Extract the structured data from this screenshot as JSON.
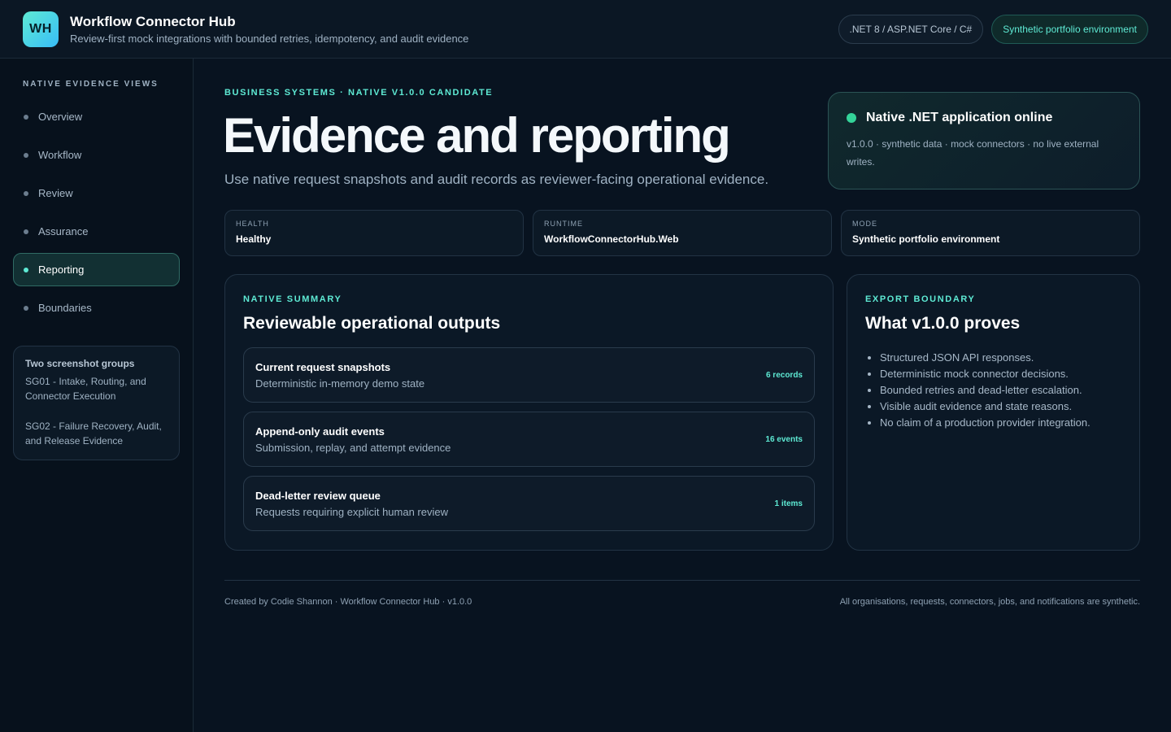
{
  "header": {
    "logo_text": "WH",
    "title": "Workflow Connector Hub",
    "subtitle": "Review-first mock integrations with bounded retries, idempotency, and audit evidence",
    "pill_stack": ".NET 8 / ASP.NET Core / C#",
    "pill_env": "Synthetic portfolio environment"
  },
  "sidebar": {
    "heading": "NATIVE EVIDENCE VIEWS",
    "items": [
      {
        "label": "Overview"
      },
      {
        "label": "Workflow"
      },
      {
        "label": "Review"
      },
      {
        "label": "Assurance"
      },
      {
        "label": "Reporting"
      },
      {
        "label": "Boundaries"
      }
    ],
    "active_item": "Reporting",
    "card": {
      "title": "Two screenshot groups",
      "line1": "SG01 - Intake, Routing, and Connector Execution",
      "line2": "SG02 - Failure Recovery, Audit, and Release Evidence"
    }
  },
  "main": {
    "eyebrow": "BUSINESS SYSTEMS · NATIVE V1.0.0 CANDIDATE",
    "title": "Evidence and reporting",
    "subtitle": "Use native request snapshots and audit records as reviewer-facing operational evidence.",
    "status": {
      "title": "Native .NET application online",
      "text": "v1.0.0 · synthetic data · mock connectors · no live external writes."
    },
    "metrics": [
      {
        "label": "HEALTH",
        "value": "Healthy"
      },
      {
        "label": "RUNTIME",
        "value": "WorkflowConnectorHub.Web"
      },
      {
        "label": "MODE",
        "value": "Synthetic portfolio environment"
      }
    ],
    "summary": {
      "eyebrow": "NATIVE SUMMARY",
      "title": "Reviewable operational outputs",
      "rows": [
        {
          "title": "Current request snapshots",
          "sub": "Deterministic in-memory demo state",
          "count": "6 records"
        },
        {
          "title": "Append-only audit events",
          "sub": "Submission, replay, and attempt evidence",
          "count": "16 events"
        },
        {
          "title": "Dead-letter review queue",
          "sub": "Requests requiring explicit human review",
          "count": "1 items"
        }
      ]
    },
    "export": {
      "eyebrow": "EXPORT BOUNDARY",
      "title": "What v1.0.0 proves",
      "bullets": [
        "Structured JSON API responses.",
        "Deterministic mock connector decisions.",
        "Bounded retries and dead-letter escalation.",
        "Visible audit evidence and state reasons.",
        "No claim of a production provider integration."
      ]
    }
  },
  "footer": {
    "left": "Created by Codie Shannon · Workflow Connector Hub · v1.0.0",
    "right": "All organisations, requests, connectors, jobs, and notifications are synthetic."
  },
  "colors": {
    "accent": "#5eead4",
    "status_online": "#34d399",
    "background": "#081320"
  }
}
